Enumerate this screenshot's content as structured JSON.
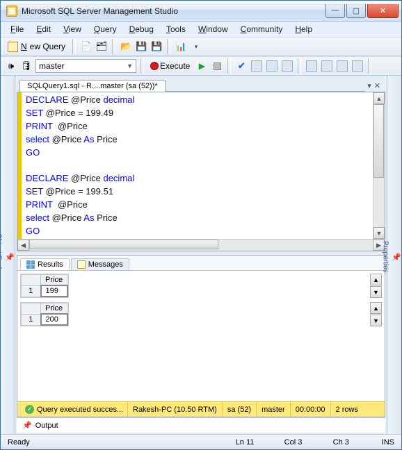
{
  "window": {
    "title": "Microsoft SQL Server Management Studio"
  },
  "menu": {
    "file": "File",
    "edit": "Edit",
    "view": "View",
    "query": "Query",
    "debug": "Debug",
    "tools": "Tools",
    "window": "Window",
    "community": "Community",
    "help": "Help"
  },
  "toolbar": {
    "new_query": "New Query",
    "database": "master",
    "execute": "Execute"
  },
  "side": {
    "left": "Object Explorer",
    "right": "Properties"
  },
  "tab": {
    "label": "SQLQuery1.sql - R....master (sa (52))*"
  },
  "sql": {
    "b1l1": "DECLARE",
    "b1l1v": " @Price ",
    "b1l1t": "decimal",
    "b1l2": "SET",
    "b1l2r": " @Price = 199.49",
    "b1l3": "PRINT",
    "b1l3r": "  @Price",
    "b1l4": "select",
    "b1l4r": " @Price ",
    "b1l4a": "As",
    "b1l4p": " Price",
    "go": "GO",
    "b2l1": "DECLARE",
    "b2l1v": " @Price ",
    "b2l1t": "decimal",
    "b2l2": "SET",
    "b2l2r": " @Price = 199.51",
    "b2l3": "PRINT",
    "b2l3r": "  @Price",
    "b2l4": "select",
    "b2l4r": " @Price ",
    "b2l4a": "As",
    "b2l4p": " Price"
  },
  "results_tabs": {
    "results": "Results",
    "messages": "Messages"
  },
  "grids": {
    "g1": {
      "header": "Price",
      "row": "1",
      "value": "199"
    },
    "g2": {
      "header": "Price",
      "row": "1",
      "value": "200"
    }
  },
  "status_yellow": {
    "msg": "Query executed succes...",
    "server": "Rakesh-PC (10.50 RTM)",
    "user": "sa (52)",
    "db": "master",
    "time": "00:00:00",
    "rows": "2 rows"
  },
  "output_tab": "Output",
  "status": {
    "ready": "Ready",
    "ln": "Ln 11",
    "col": "Col 3",
    "ch": "Ch 3",
    "ins": "INS"
  }
}
